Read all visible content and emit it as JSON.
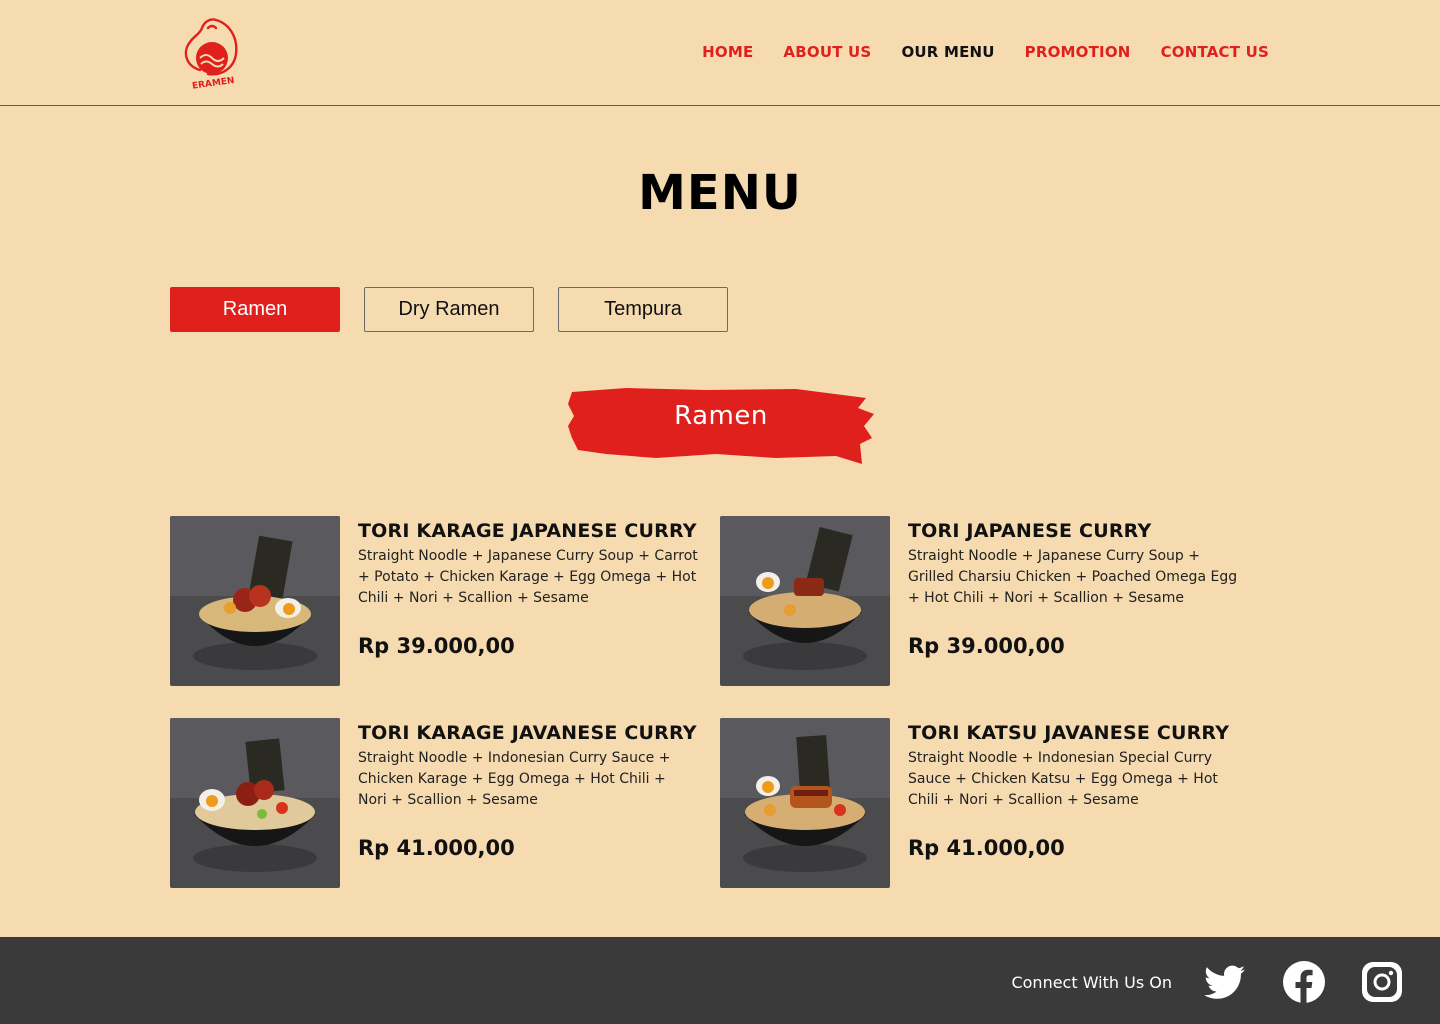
{
  "brand": {
    "logo_text": "ERAMEN"
  },
  "nav": {
    "items": [
      {
        "label": "HOME",
        "active": false
      },
      {
        "label": "ABOUT US",
        "active": false
      },
      {
        "label": "OUR MENU",
        "active": true
      },
      {
        "label": "PROMOTION",
        "active": false
      },
      {
        "label": "CONTACT US",
        "active": false
      }
    ]
  },
  "page_title": "MENU",
  "tabs": [
    {
      "label": "Ramen",
      "active": true
    },
    {
      "label": "Dry Ramen",
      "active": false
    },
    {
      "label": "Tempura",
      "active": false
    }
  ],
  "section_heading": "Ramen",
  "items": [
    {
      "name": "TORI KARAGE JAPANESE CURRY",
      "description": "Straight Noodle + Japanese Curry Soup + Carrot + Potato + Chicken Karage + Egg Omega + Hot Chili + Nori + Scallion + Sesame",
      "price": "Rp 39.000,00"
    },
    {
      "name": "TORI JAPANESE CURRY",
      "description": "Straight Noodle + Japanese Curry Soup + Grilled Charsiu Chicken + Poached Omega Egg + Hot Chili + Nori + Scallion + Sesame",
      "price": "Rp 39.000,00"
    },
    {
      "name": "TORI KARAGE JAVANESE CURRY",
      "description": "Straight Noodle + Indonesian Curry Sauce + Chicken Karage + Egg Omega + Hot Chili + Nori + Scallion + Sesame",
      "price": "Rp 41.000,00"
    },
    {
      "name": "TORI KATSU JAVANESE CURRY",
      "description": "Straight Noodle + Indonesian Special Curry Sauce + Chicken Katsu + Egg Omega + Hot Chili + Nori + Scallion + Sesame",
      "price": "Rp 41.000,00"
    }
  ],
  "footer": {
    "connect_label": "Connect With Us On",
    "social": [
      "twitter-icon",
      "facebook-icon",
      "instagram-icon"
    ]
  },
  "colors": {
    "background": "#f6dbb0",
    "accent": "#e0201c",
    "footer": "#3a3a3a"
  }
}
